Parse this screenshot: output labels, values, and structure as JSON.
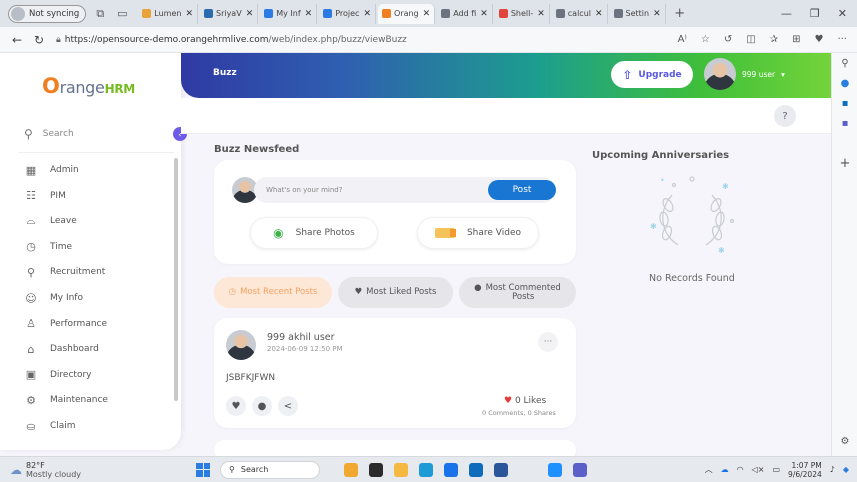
{
  "browser": {
    "profile_label": "Not syncing",
    "tabs": [
      {
        "label": "Lumen",
        "color": "#e8a13b",
        "active": false
      },
      {
        "label": "SriyaV",
        "color": "#2b6cb0",
        "active": false
      },
      {
        "label": "My Inf",
        "color": "#2c7be5",
        "active": false
      },
      {
        "label": "Projec",
        "color": "#2c7be5",
        "active": false
      },
      {
        "label": "Orang",
        "color": "#f07f22",
        "active": true
      },
      {
        "label": "Add fi",
        "color": "#6b7280",
        "active": false
      },
      {
        "label": "Shell-",
        "color": "#e0443b",
        "active": false
      },
      {
        "label": "calcul",
        "color": "#6b7280",
        "active": false
      },
      {
        "label": "Settin",
        "color": "#6b7280",
        "active": false
      }
    ],
    "url_host": "https://opensource-demo.orangehrmlive.com",
    "url_path": "/web/index.php/buzz/viewBuzz"
  },
  "app": {
    "logo_o": "O",
    "logo_text": "range",
    "logo_hrm": "HRM",
    "search_label": "Search",
    "collapse_glyph": "‹",
    "menu": [
      {
        "label": "Admin",
        "icon": "admin-icon",
        "glyph": "▦"
      },
      {
        "label": "PIM",
        "icon": "pim-icon",
        "glyph": "☷"
      },
      {
        "label": "Leave",
        "icon": "leave-icon",
        "glyph": "⌓"
      },
      {
        "label": "Time",
        "icon": "time-icon",
        "glyph": "◷"
      },
      {
        "label": "Recruitment",
        "icon": "recruitment-icon",
        "glyph": "⚲"
      },
      {
        "label": "My Info",
        "icon": "my-info-icon",
        "glyph": "☺"
      },
      {
        "label": "Performance",
        "icon": "performance-icon",
        "glyph": "♙"
      },
      {
        "label": "Dashboard",
        "icon": "dashboard-icon",
        "glyph": "⌂"
      },
      {
        "label": "Directory",
        "icon": "directory-icon",
        "glyph": "▣"
      },
      {
        "label": "Maintenance",
        "icon": "maintenance-icon",
        "glyph": "⚙"
      },
      {
        "label": "Claim",
        "icon": "claim-icon",
        "glyph": "⛀"
      }
    ],
    "header": {
      "breadcrumb": "Buzz",
      "upgrade_label": "Upgrade",
      "user_name": "999 user",
      "help_glyph": "?"
    },
    "newsfeed": {
      "title": "Buzz Newsfeed",
      "composer_placeholder": "What's on your mind?",
      "post_label": "Post",
      "share_photos_label": "Share Photos",
      "share_video_label": "Share Video",
      "filters": {
        "recent": "Most Recent Posts",
        "liked": "Most Liked Posts",
        "commented_line1": "Most Commented",
        "commented_line2": "Posts"
      },
      "post": {
        "author": "999 akhil user",
        "date": "2024-06-09 12:50 PM",
        "body": "JSBFKJFWN",
        "more_glyph": "···",
        "likes": "0 Likes",
        "counts": "0 Comments, 0 Shares"
      }
    },
    "anniversaries": {
      "title": "Upcoming Anniversaries",
      "empty_text": "No Records Found"
    },
    "accent_color": "#f07f22",
    "primary_color": "#1976d2"
  },
  "taskbar": {
    "temperature": "82°F",
    "weather": "Mostly cloudy",
    "search_label": "Search",
    "time": "1:07 PM",
    "date": "9/6/2024"
  }
}
